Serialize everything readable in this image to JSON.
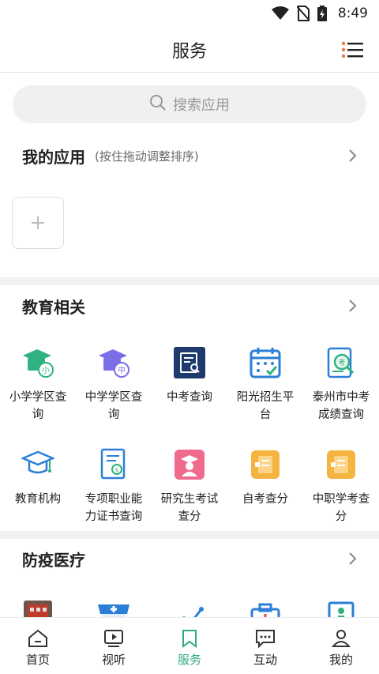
{
  "status_bar": {
    "time": "8:49"
  },
  "header": {
    "title": "服务"
  },
  "search": {
    "placeholder": "搜索应用"
  },
  "my_apps": {
    "title": "我的应用",
    "hint": "(按住拖动调整排序)"
  },
  "education": {
    "title": "教育相关",
    "items": [
      {
        "label": "小学学区查询",
        "icon": "school-district-primary-icon"
      },
      {
        "label": "中学学区查询",
        "icon": "school-district-middle-icon"
      },
      {
        "label": "中考查询",
        "icon": "exam-query-icon"
      },
      {
        "label": "阳光招生平台",
        "icon": "calendar-enroll-icon"
      },
      {
        "label": "泰州市中考成绩查询",
        "icon": "score-query-icon"
      },
      {
        "label": "教育机构",
        "icon": "graduation-cap-icon"
      },
      {
        "label": "专项职业能力证书查询",
        "icon": "certificate-icon"
      },
      {
        "label": "研究生考试查分",
        "icon": "postgraduate-icon"
      },
      {
        "label": "自考查分",
        "icon": "self-exam-icon"
      },
      {
        "label": "中职学考查分",
        "icon": "vocational-exam-icon"
      }
    ]
  },
  "epidemic": {
    "title": "防疫医疗",
    "items": [
      {
        "icon": "hospital-building-icon"
      },
      {
        "icon": "pharmacy-icon"
      },
      {
        "icon": "health-chart-icon"
      },
      {
        "icon": "medical-kit-icon"
      },
      {
        "icon": "clinic-icon"
      }
    ]
  },
  "tabs": [
    {
      "label": "首页",
      "icon": "home-icon"
    },
    {
      "label": "视听",
      "icon": "video-icon"
    },
    {
      "label": "服务",
      "icon": "bookmark-icon"
    },
    {
      "label": "互动",
      "icon": "chat-icon"
    },
    {
      "label": "我的",
      "icon": "user-icon"
    }
  ],
  "colors": {
    "accent": "#2fa87a",
    "green": "#2fb27f",
    "purple": "#7b6ee6",
    "blue": "#2b7fd6",
    "navy": "#1f3a6d",
    "orange": "#f5b340",
    "pink": "#f06a8d"
  }
}
